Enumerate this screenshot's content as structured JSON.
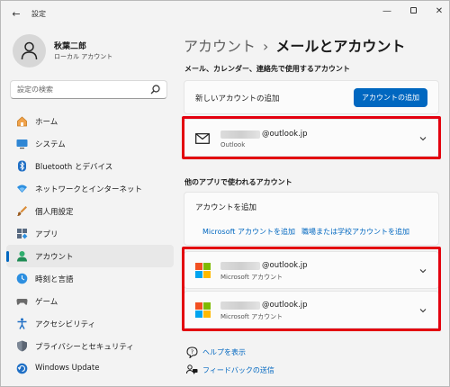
{
  "window": {
    "title": "設定"
  },
  "profile": {
    "name": "秋葉二郎",
    "account_type": "ローカル アカウント"
  },
  "search": {
    "placeholder": "設定の検索"
  },
  "sidebar": {
    "items": [
      {
        "label": "ホーム",
        "icon": "home-icon"
      },
      {
        "label": "システム",
        "icon": "system-icon"
      },
      {
        "label": "Bluetooth とデバイス",
        "icon": "bluetooth-icon"
      },
      {
        "label": "ネットワークとインターネット",
        "icon": "network-icon"
      },
      {
        "label": "個人用設定",
        "icon": "personalization-icon"
      },
      {
        "label": "アプリ",
        "icon": "apps-icon"
      },
      {
        "label": "アカウント",
        "icon": "accounts-icon",
        "active": true
      },
      {
        "label": "時刻と言語",
        "icon": "time-language-icon"
      },
      {
        "label": "ゲーム",
        "icon": "gaming-icon"
      },
      {
        "label": "アクセシビリティ",
        "icon": "accessibility-icon"
      },
      {
        "label": "プライバシーとセキュリティ",
        "icon": "privacy-icon"
      },
      {
        "label": "Windows Update",
        "icon": "windows-update-icon"
      }
    ]
  },
  "breadcrumb": {
    "parent": "アカウント",
    "separator": "›",
    "current": "メールとアカウント"
  },
  "email_section": {
    "title": "メール、カレンダー、連絡先で使用するアカウント",
    "add_label": "新しいアカウントの追加",
    "add_button": "アカウントの追加",
    "account": {
      "email_suffix": "@outlook.jp",
      "provider": "Outlook"
    }
  },
  "other_section": {
    "title": "他のアプリで使われるアカウント",
    "add_label": "アカウントを追加",
    "link_microsoft": "Microsoft アカウントを追加",
    "link_work": "職場または学校アカウントを追加",
    "accounts": [
      {
        "email_suffix": "@outlook.jp",
        "provider": "Microsoft アカウント"
      },
      {
        "email_suffix": "@outlook.jp",
        "provider": "Microsoft アカウント"
      }
    ]
  },
  "footer": {
    "help": "ヘルプを表示",
    "feedback": "フィードバックの送信"
  },
  "colors": {
    "accent": "#0067c0",
    "highlight": "#e3000f"
  }
}
